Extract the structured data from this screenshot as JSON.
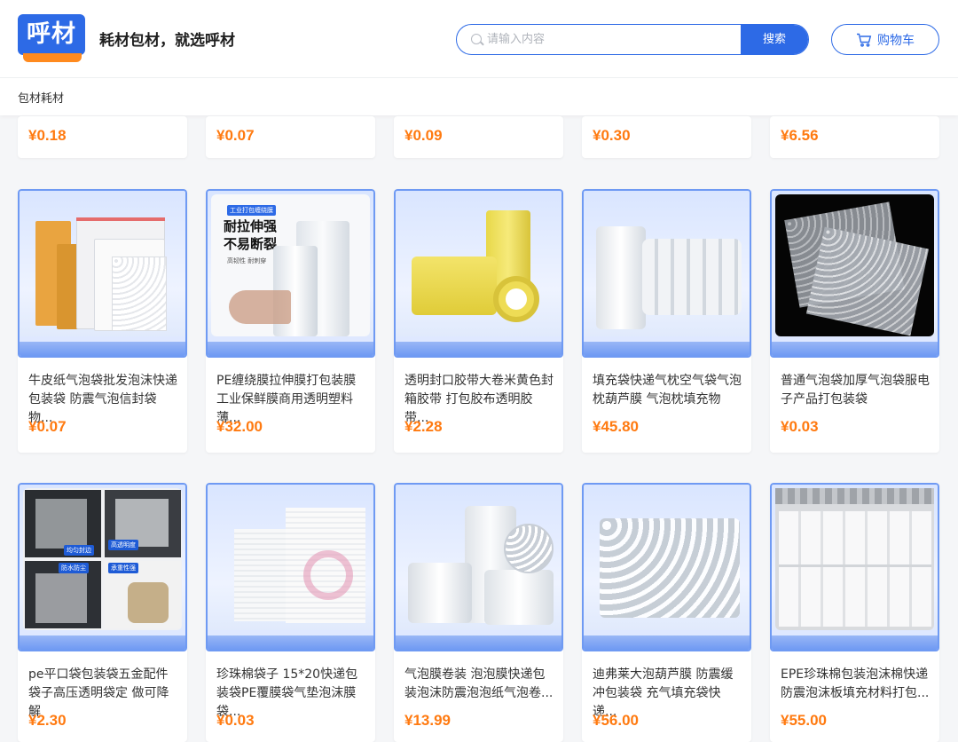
{
  "header": {
    "logo_text": "呼材",
    "slogan": "耗材包材，就选呼材",
    "search_placeholder": "请输入内容",
    "search_button": "搜索",
    "cart_label": "购物车"
  },
  "subnav": {
    "breadcrumb": "包材耗材"
  },
  "top_row_prices": [
    "¥0.18",
    "¥0.07",
    "¥0.09",
    "¥0.30",
    "¥6.56"
  ],
  "row1": [
    {
      "title": "牛皮纸气泡袋批发泡沫快递包装袋 防震气泡信封袋物...",
      "price": "¥0.07",
      "image_icon": "bubble-mailer-image"
    },
    {
      "title": "PE缠绕膜拉伸膜打包装膜工业保鲜膜商用透明塑料薄...",
      "price": "¥32.00",
      "image_icon": "stretch-film-image",
      "promo_tag": "工业打包缠绕膜",
      "promo_line1": "耐拉伸强",
      "promo_line2": "不易断裂",
      "promo_sub": "高韧性 耐刺穿"
    },
    {
      "title": "透明封口胶带大卷米黄色封箱胶带 打包胶布透明胶带...",
      "price": "¥2.28",
      "image_icon": "packing-tape-image"
    },
    {
      "title": "填充袋快递气枕空气袋气泡枕葫芦膜 气泡枕填充物",
      "price": "¥45.80",
      "image_icon": "air-pillow-image"
    },
    {
      "title": "普通气泡袋加厚气泡袋服电子产品打包装袋",
      "price": "¥0.03",
      "image_icon": "bubble-bag-image"
    }
  ],
  "row2": [
    {
      "title": "pe平口袋包装袋五金配件袋子高压透明袋定 做可降解",
      "price": "¥2.30",
      "image_icon": "pe-flat-bag-image",
      "tags": [
        "均匀封边",
        "高透明度",
        "防水防尘",
        "承重性强"
      ]
    },
    {
      "title": "珍珠棉袋子 15*20快递包装袋PE覆膜袋气垫泡沫膜袋...",
      "price": "¥0.03",
      "image_icon": "pearl-cotton-bag-image"
    },
    {
      "title": "气泡膜卷装 泡泡膜快递包装泡沫防震泡泡纸气泡卷...",
      "price": "¥13.99",
      "image_icon": "bubble-wrap-roll-image"
    },
    {
      "title": "迪弗莱大泡葫芦膜 防震缓冲包装袋 充气填充袋快递...",
      "price": "¥56.00",
      "image_icon": "gourd-film-image"
    },
    {
      "title": "EPE珍珠棉包装泡沫棉快递防震泡沫板填充材料打包...",
      "price": "¥55.00",
      "image_icon": "epe-foam-roll-image"
    }
  ],
  "colors": {
    "brand": "#2d6ae6",
    "price": "#ff7a10",
    "accent": "#ff8a1e"
  }
}
